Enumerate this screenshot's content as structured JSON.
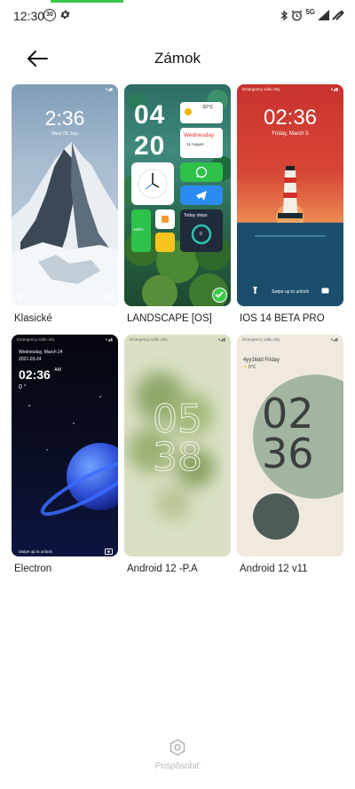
{
  "status_bar": {
    "time": "12:30",
    "badge": "30",
    "network": "5G"
  },
  "header": {
    "title": "Zámok"
  },
  "themes": [
    {
      "label": "Klasické",
      "clock": "2:36",
      "date": "Wed 29 July",
      "selected": false
    },
    {
      "label": "LANDSCAPE [OS]",
      "hour": "04",
      "minute": "20",
      "temperature": "32°C",
      "day": "Wednesday",
      "date": "11 August",
      "steps_title": "Today steps",
      "steps_value": "0",
      "battery": "100%",
      "selected": true
    },
    {
      "label": "IOS 14 BETA PRO",
      "status_text": "Emergency calls only",
      "clock": "02:36",
      "date": "Friday, March 5",
      "unlock_text": "Swipe up to unlock",
      "selected": false
    },
    {
      "label": "Electron",
      "status_text": "Emergency calls only",
      "day": "Wednesday, March 24",
      "date": "2021-03-24",
      "clock": "02:36",
      "ampm": "AM",
      "temperature": "0 °",
      "unlock_text": "Swipe up to unlock",
      "selected": false
    },
    {
      "label": "Android 12 -P.A",
      "status_text": "Emergency calls only",
      "hour": "05",
      "minute": "38",
      "selected": false
    },
    {
      "label": "Android 12 v11",
      "status_text": "Emergency calls only",
      "date": "4yy16dd Friday",
      "temperature": "0°C",
      "hour": "02",
      "minute": "36",
      "selected": false
    }
  ],
  "bottom_action": {
    "label": "Prispôsobiť"
  },
  "colors": {
    "accent_green": "#3bc84a",
    "bottom_label": "#b7b7b7"
  }
}
